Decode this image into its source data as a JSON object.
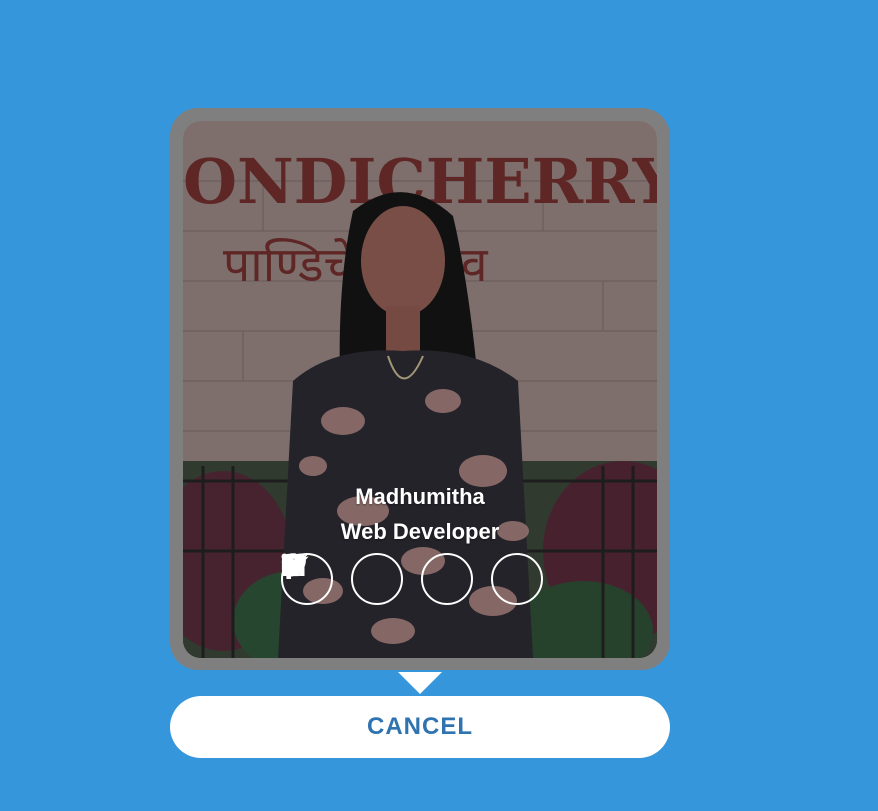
{
  "profile": {
    "name": "Madhumitha",
    "role": "Web Developer",
    "photo_sign_text": "ONDICHERRY U",
    "photo_sign_text_hindi": "पाण्डिचेरी विश्व"
  },
  "socials": [
    {
      "icon": "facebook-icon"
    },
    {
      "icon": "twitter-icon"
    },
    {
      "icon": "linkedin-icon"
    },
    {
      "icon": "instagram-icon"
    }
  ],
  "actions": {
    "cancel_label": "CANCEL"
  },
  "colors": {
    "background": "#3596db",
    "frame": "#7f7f7f",
    "cancel_text": "#2f74b0"
  }
}
